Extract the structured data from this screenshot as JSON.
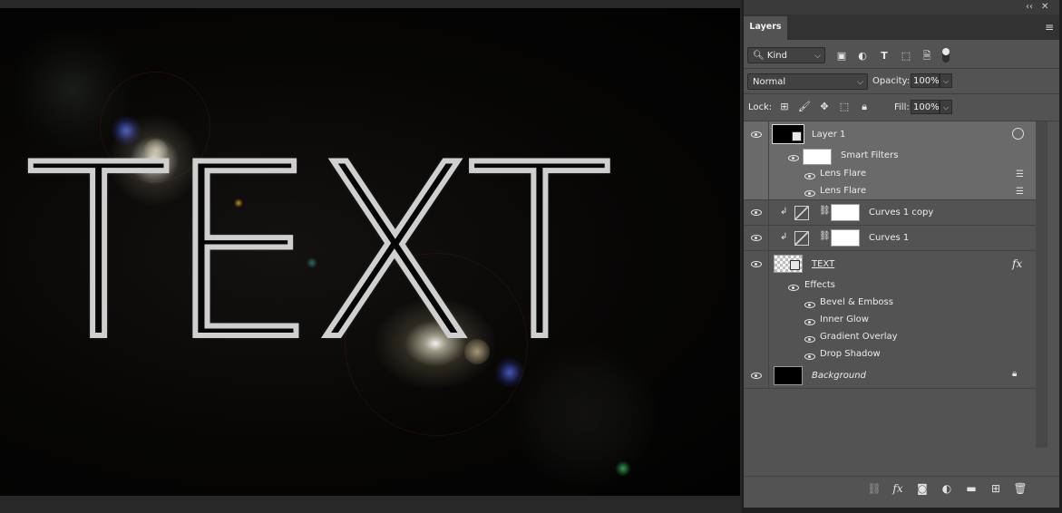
{
  "canvas": {
    "artwork_text": "TEXT"
  },
  "panel": {
    "tab_label": "Layers",
    "filter": {
      "kind_label": "Kind",
      "icons": [
        "image-filter-icon",
        "adjustment-filter-icon",
        "type-filter-icon",
        "shape-filter-icon",
        "smart-object-filter-icon",
        "filter-toggle-icon"
      ]
    },
    "blend_mode": "Normal",
    "opacity_label": "Opacity:",
    "opacity_value": "100%",
    "lock_label": "Lock:",
    "fill_label": "Fill:",
    "fill_value": "100%"
  },
  "layers": {
    "layer1": {
      "name": "Layer 1",
      "smart_filters_label": "Smart Filters",
      "filters": [
        "Lens Flare",
        "Lens Flare"
      ]
    },
    "curves_copy": {
      "name": "Curves 1 copy"
    },
    "curves": {
      "name": "Curves 1"
    },
    "text": {
      "name": "TEXT",
      "fx_label": "fx",
      "effects_label": "Effects",
      "effects": [
        "Bevel & Emboss",
        "Inner Glow",
        "Gradient Overlay",
        "Drop Shadow"
      ]
    },
    "background": {
      "name": "Background"
    }
  },
  "colors": {
    "panel_bg": "#535353",
    "selected_row": "#6a6a6a",
    "canvas_bg": "#050505"
  }
}
